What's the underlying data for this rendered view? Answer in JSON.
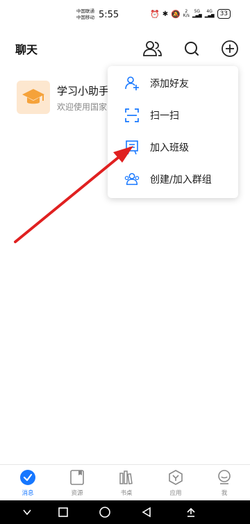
{
  "status_bar": {
    "carrier_1": "中国联通",
    "carrier_2": "中国移动",
    "time": "5:55",
    "net_speed_value": "2",
    "net_speed_unit": "K/s",
    "network_type": "5G",
    "network_type_2": "4G",
    "battery": "33"
  },
  "header": {
    "title": "聊天",
    "icons": [
      "contacts-icon",
      "search-icon",
      "add-circle-icon"
    ]
  },
  "chat_list": [
    {
      "name": "学习小助手",
      "preview": "欢迎使用国家",
      "avatar_icon": "graduation-cap-icon",
      "avatar_color": "#fde7cf",
      "icon_color": "#f5a23a"
    }
  ],
  "popup_menu": {
    "items": [
      {
        "label": "添加好友",
        "icon": "add-friend-icon"
      },
      {
        "label": "扫一扫",
        "icon": "scan-icon"
      },
      {
        "label": "加入班级",
        "icon": "join-class-icon"
      },
      {
        "label": "创建/加入群组",
        "icon": "group-icon"
      }
    ]
  },
  "bottom_nav": {
    "items": [
      {
        "label": "消息",
        "icon": "message-icon",
        "active": true
      },
      {
        "label": "资源",
        "icon": "resource-icon",
        "active": false
      },
      {
        "label": "书桌",
        "icon": "desk-icon",
        "active": false
      },
      {
        "label": "应用",
        "icon": "app-icon",
        "active": false
      },
      {
        "label": "我",
        "icon": "profile-icon",
        "active": false
      }
    ]
  },
  "colors": {
    "accent": "#1677ff",
    "annotation_arrow": "#e02020",
    "inactive_icon": "#888888"
  }
}
